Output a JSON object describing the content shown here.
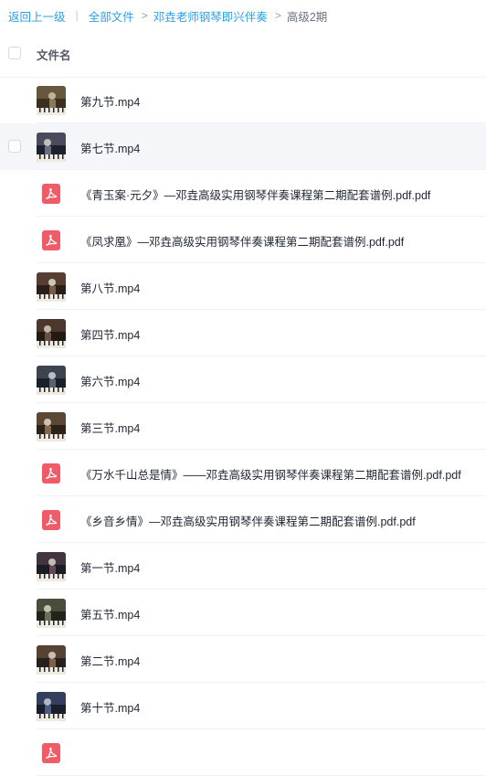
{
  "breadcrumb": {
    "back": "返回上一级",
    "separator": "|",
    "all_files": "全部文件",
    "arrow": ">",
    "folder": "邓垚老师钢琴即兴伴奏",
    "current": "高级2期"
  },
  "header": {
    "column_name": "文件名"
  },
  "files": [
    {
      "name": "第九节.mp4",
      "type": "video",
      "icon": "video-thumbnail"
    },
    {
      "name": "第七节.mp4",
      "type": "video",
      "icon": "video-thumbnail",
      "hover": true
    },
    {
      "name": "《青玉案·元夕》—邓垚高级实用钢琴伴奏课程第二期配套谱例.pdf.pdf",
      "type": "pdf",
      "icon": "pdf-icon"
    },
    {
      "name": "《凤求凰》—邓垚高级实用钢琴伴奏课程第二期配套谱例.pdf.pdf",
      "type": "pdf",
      "icon": "pdf-icon"
    },
    {
      "name": "第八节.mp4",
      "type": "video",
      "icon": "video-thumbnail"
    },
    {
      "name": "第四节.mp4",
      "type": "video",
      "icon": "video-thumbnail"
    },
    {
      "name": "第六节.mp4",
      "type": "video",
      "icon": "video-thumbnail"
    },
    {
      "name": "第三节.mp4",
      "type": "video",
      "icon": "video-thumbnail"
    },
    {
      "name": "《万水千山总是情》——邓垚高级实用钢琴伴奏课程第二期配套谱例.pdf.pdf",
      "type": "pdf",
      "icon": "pdf-icon"
    },
    {
      "name": "《乡音乡情》—邓垚高级实用钢琴伴奏课程第二期配套谱例.pdf.pdf",
      "type": "pdf",
      "icon": "pdf-icon"
    },
    {
      "name": "第一节.mp4",
      "type": "video",
      "icon": "video-thumbnail"
    },
    {
      "name": "第五节.mp4",
      "type": "video",
      "icon": "video-thumbnail"
    },
    {
      "name": "第二节.mp4",
      "type": "video",
      "icon": "video-thumbnail"
    },
    {
      "name": "第十节.mp4",
      "type": "video",
      "icon": "video-thumbnail"
    },
    {
      "name": "",
      "type": "pdf",
      "icon": "pdf-icon"
    }
  ],
  "colors": {
    "link": "#2aa0e6",
    "pdf": "#ef5b67",
    "hover_row": "#f4f6fa"
  }
}
